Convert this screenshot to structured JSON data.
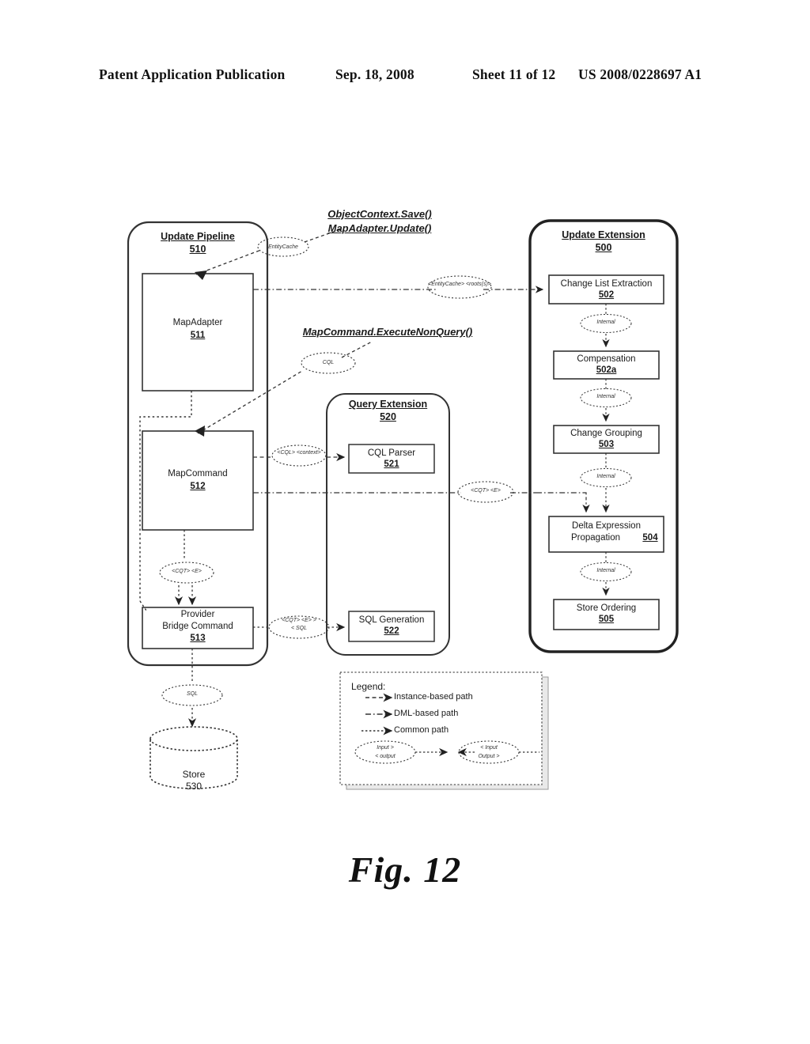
{
  "header": {
    "publication": "Patent Application Publication",
    "date": "Sep. 18, 2008",
    "sheet": "Sheet 11 of 12",
    "patent_number": "US 2008/0228697 A1"
  },
  "figure": {
    "caption": "Fig. 12"
  },
  "callouts": {
    "object_context_save": "ObjectContext.Save()",
    "map_adapter_update": "MapAdapter.Update()",
    "map_command_exec": "MapCommand.ExecuteNonQuery()"
  },
  "panels": {
    "update_pipeline": {
      "title": "Update Pipeline",
      "number": "510"
    },
    "query_extension": {
      "title": "Query Extension",
      "number": "520"
    },
    "update_extension": {
      "title": "Update Extension",
      "number": "500"
    }
  },
  "boxes": {
    "map_adapter": {
      "label": "MapAdapter",
      "number": "511"
    },
    "map_command": {
      "label": "MapCommand",
      "number": "512"
    },
    "provider_bridge": {
      "label_line1": "Provider",
      "label_line2": "Bridge Command",
      "number": "513"
    },
    "cql_parser": {
      "label": "CQL Parser",
      "number": "521"
    },
    "sql_generation": {
      "label": "SQL Generation",
      "number": "522"
    },
    "change_list_extraction": {
      "label": "Change List Extraction",
      "number": "502"
    },
    "compensation": {
      "label": "Compensation",
      "number": "502a"
    },
    "change_grouping": {
      "label": "Change Grouping",
      "number": "503"
    },
    "delta_expression": {
      "label_line1": "Delta Expression",
      "label_line2": "Propagation",
      "number": "504"
    },
    "store_ordering": {
      "label": "Store Ordering",
      "number": "505"
    }
  },
  "store": {
    "label": "Store",
    "number": "530"
  },
  "pills": {
    "entity_cache": "EntityCache",
    "entity_cache_roots": "<EntityCache> <roots(s)>",
    "cql": "CQL",
    "cql_context": "<CQL> <context>",
    "cqt_e_mid": "<CQT> <E>",
    "cqt_e_left": "<CQT> <E>",
    "cqt_e_sql_l1": "<CQT> <E> >",
    "cqt_e_sql_l2": "< SQL",
    "sql": "SQL",
    "internal": "Internal"
  },
  "legend": {
    "title": "Legend:",
    "items": [
      {
        "label": "Instance-based path",
        "style": "dashed"
      },
      {
        "label": "DML-based path",
        "style": "dash-dot"
      },
      {
        "label": "Common path",
        "style": "dotted"
      }
    ],
    "input_output_left_l1": "Input >",
    "input_output_left_l2": "< output",
    "input_output_right_l1": "< Input",
    "input_output_right_l2": "Output >"
  },
  "colors": {
    "ink": "#1a1a1a",
    "line": "#333333",
    "shadow": "#bdbdbd"
  }
}
